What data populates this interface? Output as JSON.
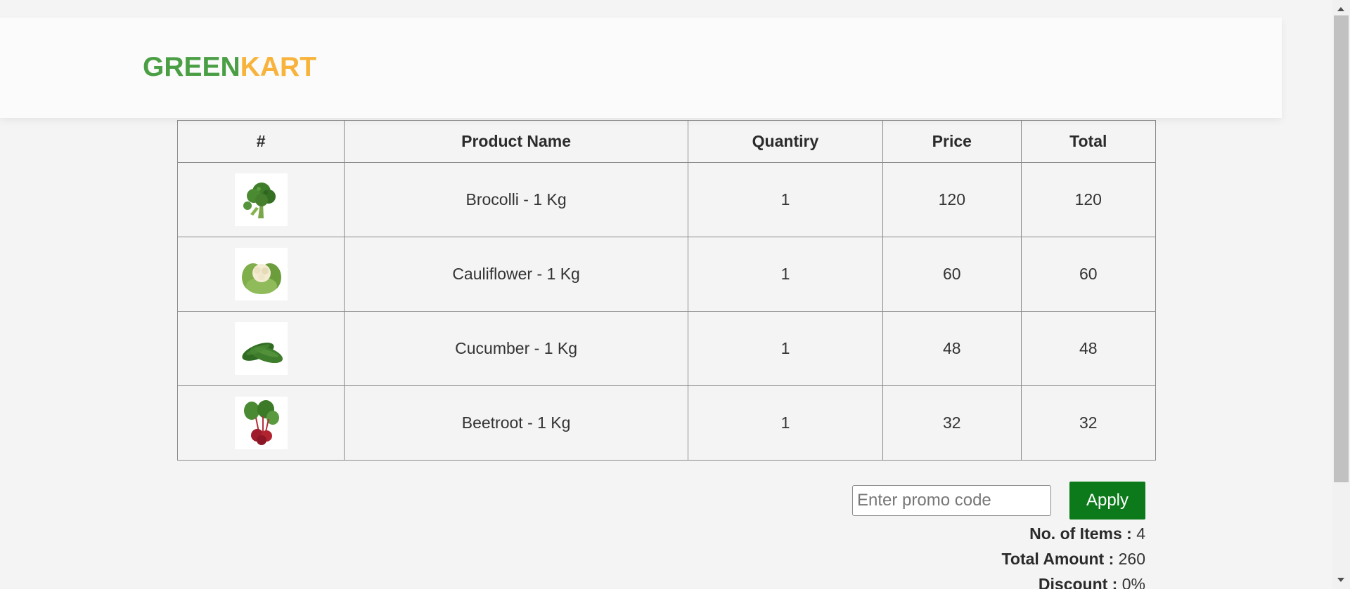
{
  "brand": {
    "part1": "GREEN",
    "part2": "KART",
    "color1": "#4a9f45",
    "color2": "#f7b33b"
  },
  "table": {
    "headers": [
      "#",
      "Product Name",
      "Quantiry",
      "Price",
      "Total"
    ],
    "rows": [
      {
        "image": "broccoli-image",
        "name": "Brocolli - 1 Kg",
        "quantity": "1",
        "price": "120",
        "total": "120"
      },
      {
        "image": "cauliflower-image",
        "name": "Cauliflower - 1 Kg",
        "quantity": "1",
        "price": "60",
        "total": "60"
      },
      {
        "image": "cucumber-image",
        "name": "Cucumber - 1 Kg",
        "quantity": "1",
        "price": "48",
        "total": "48"
      },
      {
        "image": "beetroot-image",
        "name": "Beetroot - 1 Kg",
        "quantity": "1",
        "price": "32",
        "total": "32"
      }
    ]
  },
  "promo": {
    "placeholder": "Enter promo code",
    "value": "",
    "apply_label": "Apply",
    "apply_color": "#0c7a1a"
  },
  "summary": {
    "items_label": "No. of Items :",
    "items_value": "4",
    "amount_label": "Total Amount :",
    "amount_value": "260",
    "discount_label": "Discount :",
    "discount_value": "0%"
  }
}
